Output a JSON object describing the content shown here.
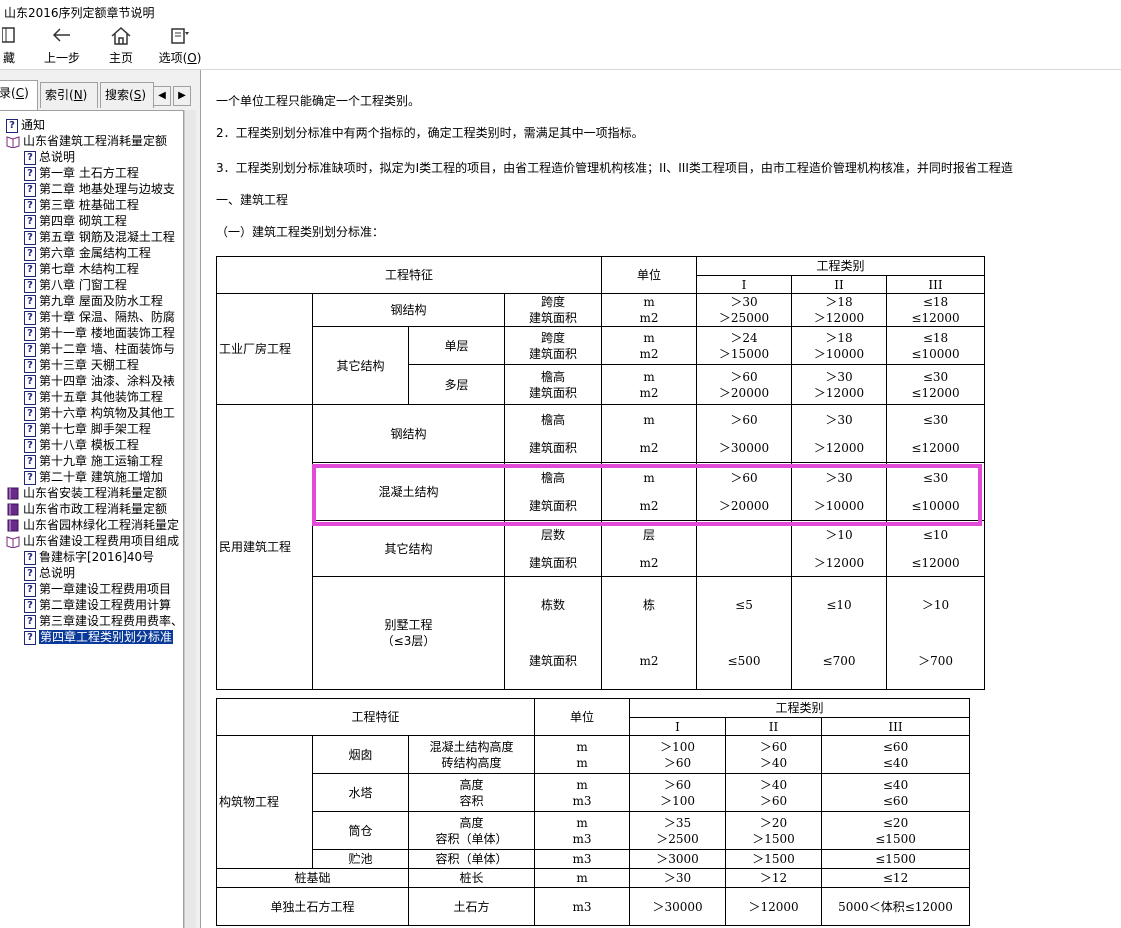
{
  "window": {
    "title": "山东2016序列定额章节说明"
  },
  "toolbar": {
    "hide": {
      "label": "隐藏",
      "visible": "藏"
    },
    "back": {
      "label": "上一步"
    },
    "home": {
      "label": "主页"
    },
    "options": {
      "label": "选项(",
      "key": "O",
      "suffix": ")"
    }
  },
  "tabs": [
    {
      "label": "录(",
      "key": "C",
      "suffix": ")"
    },
    {
      "label": "索引(",
      "key": "N",
      "suffix": ")"
    },
    {
      "label": "搜索(",
      "key": "S",
      "suffix": ")"
    }
  ],
  "tree": [
    {
      "label": "通知",
      "icon": "page",
      "level": 0
    },
    {
      "label": "山东省建筑工程消耗量定额",
      "icon": "book-open",
      "level": 0
    },
    {
      "label": "总说明",
      "icon": "page",
      "level": 1
    },
    {
      "label": "第一章 土石方工程",
      "icon": "page",
      "level": 1
    },
    {
      "label": "第二章 地基处理与边坡支",
      "icon": "page",
      "level": 1
    },
    {
      "label": "第三章 桩基础工程",
      "icon": "page",
      "level": 1
    },
    {
      "label": "第四章 砌筑工程",
      "icon": "page",
      "level": 1
    },
    {
      "label": "第五章 钢筋及混凝土工程",
      "icon": "page",
      "level": 1
    },
    {
      "label": "第六章 金属结构工程",
      "icon": "page",
      "level": 1
    },
    {
      "label": "第七章 木结构工程",
      "icon": "page",
      "level": 1
    },
    {
      "label": "第八章 门窗工程",
      "icon": "page",
      "level": 1
    },
    {
      "label": "第九章 屋面及防水工程",
      "icon": "page",
      "level": 1
    },
    {
      "label": "第十章 保温、隔热、防腐",
      "icon": "page",
      "level": 1
    },
    {
      "label": "第十一章 楼地面装饰工程",
      "icon": "page",
      "level": 1
    },
    {
      "label": "第十二章 墙、柱面装饰与",
      "icon": "page",
      "level": 1
    },
    {
      "label": "第十三章 天棚工程",
      "icon": "page",
      "level": 1
    },
    {
      "label": "第十四章 油漆、涂料及裱",
      "icon": "page",
      "level": 1
    },
    {
      "label": "第十五章 其他装饰工程",
      "icon": "page",
      "level": 1
    },
    {
      "label": "第十六章 构筑物及其他工",
      "icon": "page",
      "level": 1
    },
    {
      "label": "第十七章 脚手架工程",
      "icon": "page",
      "level": 1
    },
    {
      "label": "第十八章 模板工程",
      "icon": "page",
      "level": 1
    },
    {
      "label": "第十九章 施工运输工程",
      "icon": "page",
      "level": 1
    },
    {
      "label": "第二十章 建筑施工增加",
      "icon": "page",
      "level": 1
    },
    {
      "label": "山东省安装工程消耗量定额",
      "icon": "book-closed",
      "level": 0
    },
    {
      "label": "山东省市政工程消耗量定额",
      "icon": "book-closed",
      "level": 0
    },
    {
      "label": "山东省园林绿化工程消耗量定",
      "icon": "book-closed",
      "level": 0
    },
    {
      "label": "山东省建设工程费用项目组成",
      "icon": "book-open",
      "level": 0
    },
    {
      "label": "鲁建标字[2016]40号",
      "icon": "page",
      "level": 1
    },
    {
      "label": "总说明",
      "icon": "page",
      "level": 1
    },
    {
      "label": "第一章建设工程费用项目",
      "icon": "page",
      "level": 1
    },
    {
      "label": "第二章建设工程费用计算",
      "icon": "page",
      "level": 1
    },
    {
      "label": "第三章建设工程费用费率、",
      "icon": "page",
      "level": 1
    },
    {
      "label": "第四章工程类别划分标准",
      "icon": "page",
      "level": 1,
      "selected": true
    }
  ],
  "content": {
    "p1": "一个单位工程只能确定一个工程类别。",
    "p2": "2．工程类别划分标准中有两个指标的，确定工程类别时，需满足其中一项指标。",
    "p3": "3．工程类别划分标准缺项时，拟定为I类工程的项目，由省工程造价管理机构核准；II、III类工程项目，由市工程造价管理机构核准，并同时报省工程造",
    "h1": "一、建筑工程",
    "h2": "（一）建筑工程类别划分标准："
  },
  "table1": {
    "h_feature": "工程特征",
    "h_unit": "单位",
    "h_category": "工程类别",
    "h_I": "I",
    "h_II": "II",
    "h_III": "III",
    "ind": "工业厂房工程",
    "steel": "钢结构",
    "other": "其它结构",
    "single": "单层",
    "multi": "多层",
    "span": "跨度",
    "area": "建筑面积",
    "eave": "檐高",
    "civil": "民用建筑工程",
    "concrete": "混凝土结构",
    "floors": "层数",
    "villa": "别墅工程",
    "villa2": "（≤3层）",
    "buildings": "栋数",
    "u_m": "m",
    "u_m2": "m2",
    "u_floor": "层",
    "u_dong": "栋",
    "r1": [
      "＞30",
      "＞18",
      "≤18"
    ],
    "r2": [
      "＞25000",
      "＞12000",
      "≤12000"
    ],
    "r3": [
      "＞24",
      "＞18",
      "≤18"
    ],
    "r4": [
      "＞15000",
      "＞10000",
      "≤10000"
    ],
    "r5": [
      "＞60",
      "＞30",
      "≤30"
    ],
    "r6": [
      "＞20000",
      "＞12000",
      "≤12000"
    ],
    "r7": [
      "＞60",
      "＞30",
      "≤30"
    ],
    "r8": [
      "＞30000",
      "＞12000",
      "≤12000"
    ],
    "r9": [
      "＞60",
      "＞30",
      "≤30"
    ],
    "r10": [
      "＞20000",
      "＞10000",
      "≤10000"
    ],
    "r11": [
      "",
      "＞10",
      "≤10"
    ],
    "r12": [
      "",
      "＞12000",
      "≤12000"
    ],
    "r13": [
      "≤5",
      "≤10",
      "＞10"
    ],
    "r14": [
      "≤500",
      "≤700",
      "＞700"
    ]
  },
  "table2": {
    "h_feature": "工程特征",
    "h_unit": "单位",
    "h_category": "工程类别",
    "h_I": "I",
    "h_II": "II",
    "h_III": "III",
    "struct": "构筑物工程",
    "chimney": "烟囱",
    "chim1": "混凝土结构高度",
    "chim2": "砖结构高度",
    "tower": "水塔",
    "height": "高度",
    "volume": "容积",
    "silo": "筒仓",
    "vol_unit": "容积（单体）",
    "pool": "贮池",
    "pile": "桩基础",
    "pile_len": "桩长",
    "earth": "单独土石方工程",
    "earthwork": "土石方",
    "u_m": "m",
    "u_m3": "m3",
    "r1": [
      "＞100",
      "＞60",
      "≤60"
    ],
    "r2": [
      "＞60",
      "＞40",
      "≤40"
    ],
    "r3": [
      "＞60",
      "＞40",
      "≤40"
    ],
    "r4": [
      "＞100",
      "＞60",
      "≤60"
    ],
    "r5": [
      "＞35",
      "＞20",
      "≤20"
    ],
    "r6": [
      "＞2500",
      "＞1500",
      "≤1500"
    ],
    "r7": [
      "＞3000",
      "＞1500",
      "≤1500"
    ],
    "r8": [
      "＞30",
      "＞12",
      "≤12"
    ],
    "r9": [
      "＞30000",
      "＞12000",
      "5000＜体积≤12000"
    ]
  }
}
